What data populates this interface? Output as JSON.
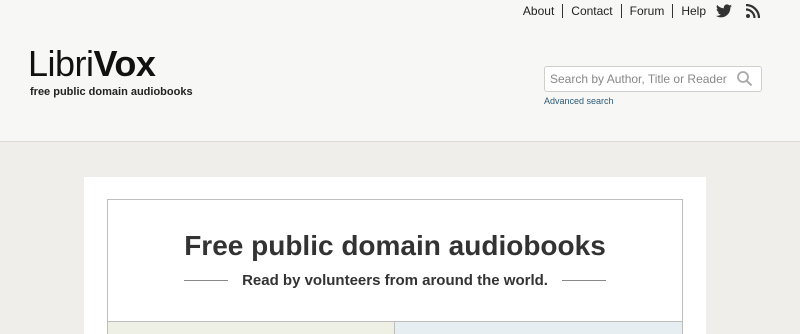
{
  "nav": {
    "links": [
      {
        "label": "About"
      },
      {
        "label": "Contact"
      },
      {
        "label": "Forum"
      },
      {
        "label": "Help"
      }
    ],
    "social": [
      {
        "icon": "twitter-icon"
      },
      {
        "icon": "rss-icon"
      }
    ]
  },
  "logo": {
    "part1": "Libri",
    "part2": "Vox"
  },
  "tagline": "free public domain audiobooks",
  "search": {
    "placeholder": "Search by Author, Title or Reader",
    "value": "",
    "advanced_label": "Advanced search"
  },
  "hero": {
    "title": "Free public domain audiobooks",
    "subtitle": "Read by volunteers from around the world."
  },
  "colors": {
    "page_bg": "#efeeea",
    "header_bg": "#f7f7f5",
    "link_blue": "#2b5a78"
  }
}
